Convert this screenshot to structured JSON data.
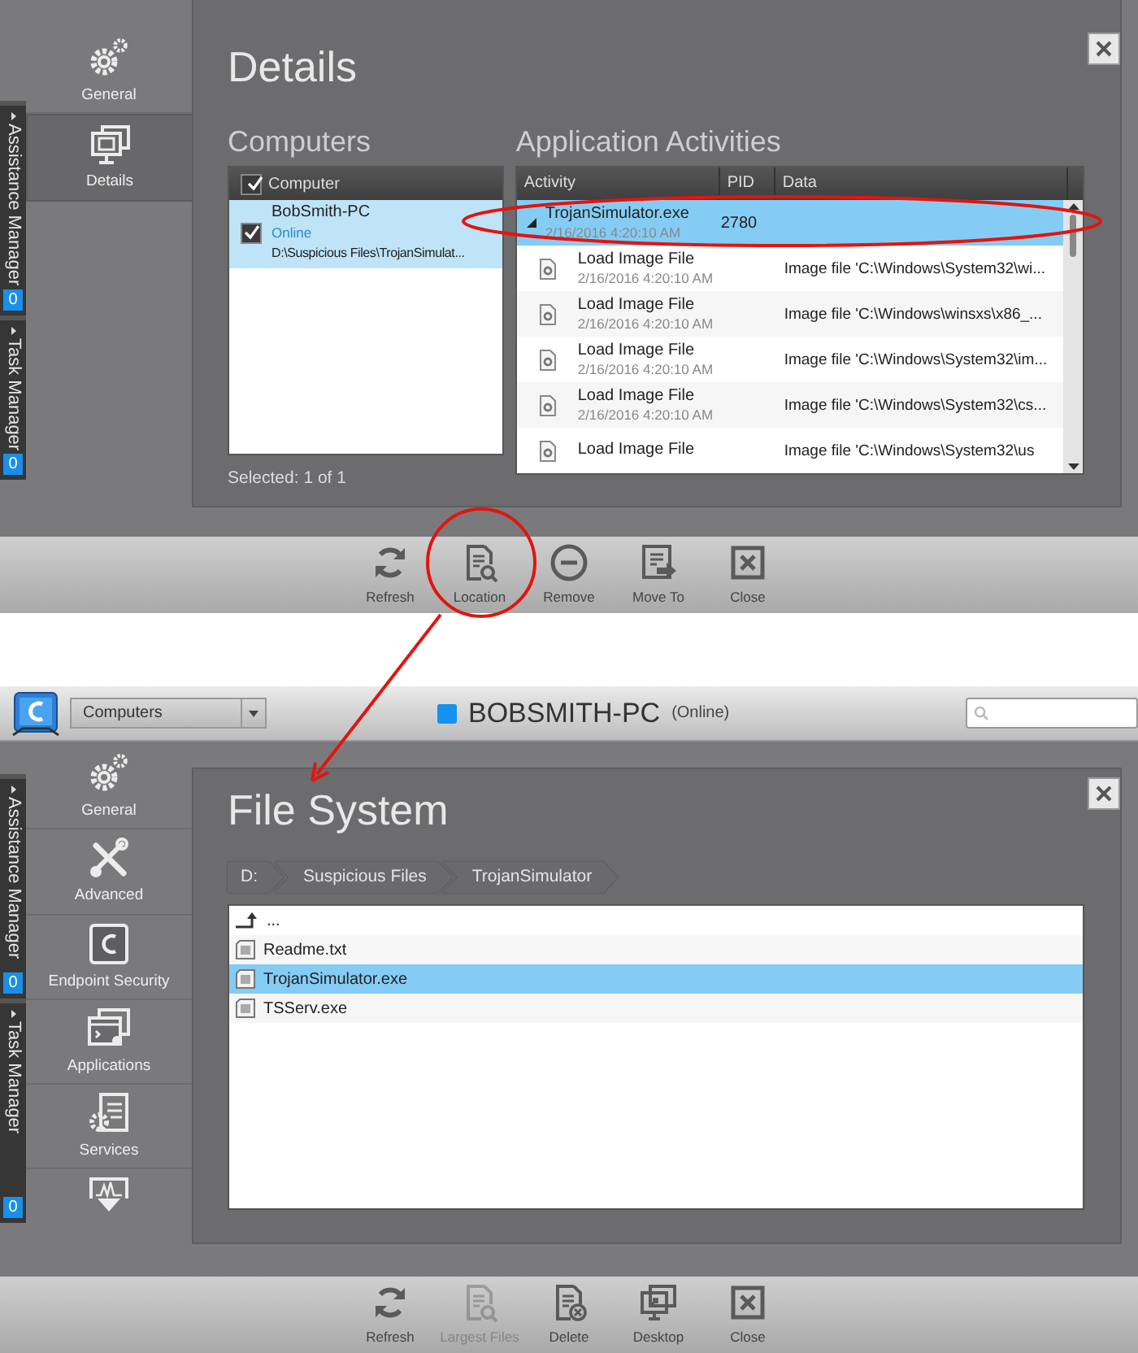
{
  "top": {
    "side_tabs": [
      {
        "label": "Assistance Manager",
        "count": "0"
      },
      {
        "label": "Task Manager",
        "count": "0"
      }
    ],
    "nav": [
      {
        "label": "General",
        "selected": false
      },
      {
        "label": "Details",
        "selected": true
      }
    ],
    "title": "Details",
    "computers": {
      "heading": "Computers",
      "column": "Computer",
      "all_checked": true,
      "rows": [
        {
          "name": "BobSmith-PC",
          "status": "Online",
          "path": "D:\\Suspicious Files\\TrojanSimulat...",
          "checked": true,
          "selected": true
        }
      ],
      "footer": "Selected: 1 of 1"
    },
    "activities": {
      "heading": "Application Activities",
      "columns": [
        "Activity",
        "PID",
        "Data"
      ],
      "rows": [
        {
          "kind": "process",
          "activity": "TrojanSimulator.exe",
          "time": "2/16/2016 4:20:10 AM",
          "pid": "2780",
          "expanded": true,
          "selected": true
        },
        {
          "kind": "event",
          "activity": "Load Image File",
          "time": "2/16/2016 4:20:10 AM",
          "data": "Image file 'C:\\Windows\\System32\\wi...",
          "selected": false
        },
        {
          "kind": "event",
          "activity": "Load Image File",
          "time": "2/16/2016 4:20:10 AM",
          "data": "Image file 'C:\\Windows\\winsxs\\x86_...",
          "selected": false
        },
        {
          "kind": "event",
          "activity": "Load Image File",
          "time": "2/16/2016 4:20:10 AM",
          "data": "Image file 'C:\\Windows\\System32\\im...",
          "selected": false
        },
        {
          "kind": "event",
          "activity": "Load Image File",
          "time": "2/16/2016 4:20:10 AM",
          "data": "Image file 'C:\\Windows\\System32\\cs...",
          "selected": false
        },
        {
          "kind": "event",
          "activity": "Load Image File",
          "data": "Image file 'C:\\Windows\\System32\\us",
          "selected": false
        }
      ]
    },
    "toolbar": [
      {
        "label": "Refresh",
        "disabled": false
      },
      {
        "label": "Location",
        "disabled": false
      },
      {
        "label": "Remove",
        "disabled": false
      },
      {
        "label": "Move To",
        "disabled": false
      },
      {
        "label": "Close",
        "disabled": false
      }
    ]
  },
  "bottom": {
    "header": {
      "dropdown": "Computers",
      "computer": "BOBSMITH-PC",
      "status": "(Online)"
    },
    "side_tabs": [
      {
        "label": "Assistance Manager",
        "count": "0"
      },
      {
        "label": "Task Manager",
        "count": "0"
      }
    ],
    "nav": [
      {
        "label": "General",
        "selected": false
      },
      {
        "label": "Advanced",
        "selected": false
      },
      {
        "label": "Endpoint Security",
        "selected": false
      },
      {
        "label": "Applications",
        "selected": false
      },
      {
        "label": "Services",
        "selected": false
      }
    ],
    "title": "File System",
    "breadcrumb": [
      "D:",
      "Suspicious Files",
      "TrojanSimulator"
    ],
    "files": [
      {
        "kind": "up",
        "name": "...",
        "selected": false
      },
      {
        "kind": "file",
        "name": "Readme.txt",
        "selected": false
      },
      {
        "kind": "file",
        "name": "TrojanSimulator.exe",
        "selected": true
      },
      {
        "kind": "file",
        "name": "TSServ.exe",
        "selected": false
      }
    ],
    "toolbar": [
      {
        "label": "Refresh",
        "disabled": false
      },
      {
        "label": "Largest Files",
        "disabled": true
      },
      {
        "label": "Delete",
        "disabled": false
      },
      {
        "label": "Desktop",
        "disabled": false
      },
      {
        "label": "Close",
        "disabled": false
      }
    ]
  }
}
